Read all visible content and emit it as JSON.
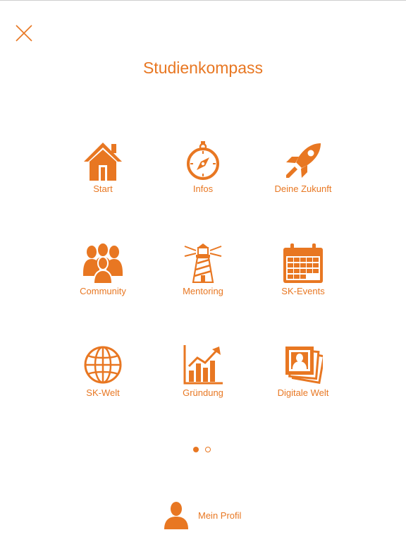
{
  "accent_color": "#e87722",
  "header": {
    "title": "Studienkompass",
    "close_icon": "close-icon"
  },
  "menu": {
    "start": {
      "label": "Start",
      "icon": "home-icon"
    },
    "infos": {
      "label": "Infos",
      "icon": "compass-icon"
    },
    "zukunft": {
      "label": "Deine Zukunft",
      "icon": "rocket-icon"
    },
    "community": {
      "label": "Community",
      "icon": "group-icon"
    },
    "mentoring": {
      "label": "Mentoring",
      "icon": "lighthouse-icon"
    },
    "events": {
      "label": "SK-Events",
      "icon": "calendar-icon"
    },
    "welt": {
      "label": "SK-Welt",
      "icon": "globe-icon"
    },
    "gruendung": {
      "label": "Gründung",
      "icon": "growth-chart-icon"
    },
    "digital": {
      "label": "Digitale Welt",
      "icon": "photos-icon"
    }
  },
  "pagination": {
    "current_page": 1,
    "total_pages": 2
  },
  "footer": {
    "profile_label": "Mein Profil",
    "profile_icon": "user-icon"
  }
}
